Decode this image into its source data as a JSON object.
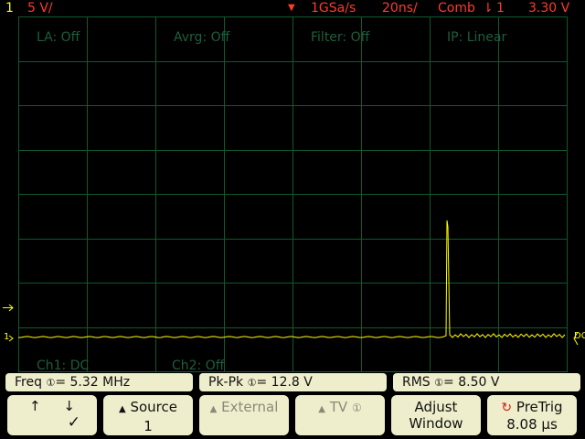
{
  "top_bar": {
    "channel": "1",
    "volts_per_div": "5 V/",
    "trigger_marker": "▼",
    "sample_rate": "1GSa/s",
    "time_per_div": "20ns/",
    "trigger_mode": "Comb",
    "trigger_source": "1",
    "trigger_level": "3.30 V"
  },
  "overlay": {
    "la": "LA: Off",
    "avrg": "Avrg: Off",
    "filter": "Filter: Off",
    "ip": "IP: Linear",
    "ch1": "Ch1: DC",
    "ch2": "Ch2: Off"
  },
  "markers": {
    "trigger_level_mark": "T",
    "ground_mark": "1",
    "right_edge": "DC"
  },
  "measurements": [
    {
      "label": "Freq",
      "value": "5.32 MHz"
    },
    {
      "label": "Pk-Pk",
      "value": "12.8  V"
    },
    {
      "label": "RMS",
      "value": "8.50  V"
    }
  ],
  "softkeys": {
    "slope_rising": "↑",
    "slope_falling": "↓",
    "slope_check": "✓",
    "source_label": "Source",
    "source_value": "1",
    "external_label": "External",
    "tv_label": "TV",
    "adjust_line1": "Adjust",
    "adjust_line2": "Window",
    "pretrig_label": "PreTrig",
    "pretrig_value": "8.08 µs"
  },
  "colors": {
    "trace": "#ffff00",
    "grid": "#0e5a2e",
    "top_text": "#ff3a2a",
    "softkey_bg": "#efeecc"
  }
}
